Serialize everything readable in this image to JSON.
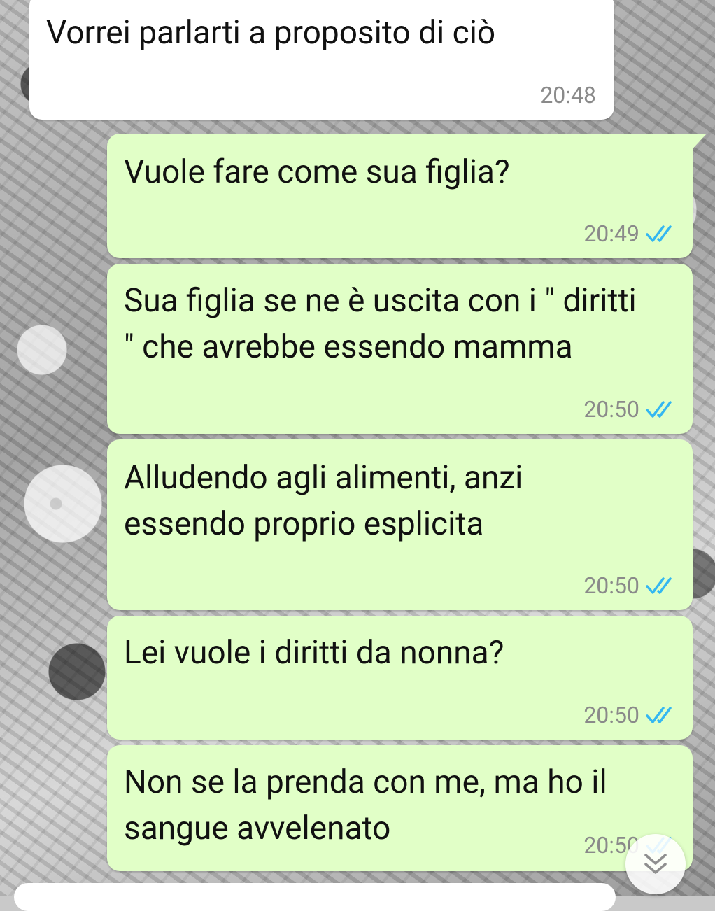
{
  "messages": [
    {
      "text": "Vorrei parlarti a proposito di ciò",
      "time": "20:48"
    },
    {
      "text": "Vuole fare come sua figlia?",
      "time": "20:49"
    },
    {
      "text": "Sua figlia se ne è uscita con i \" diritti \" che avrebbe essendo mamma",
      "time": "20:50"
    },
    {
      "text": "Alludendo agli alimenti, anzi essendo proprio esplicita",
      "time": "20:50"
    },
    {
      "text": "Lei vuole i diritti da nonna?",
      "time": "20:50"
    },
    {
      "text": "Non se la prenda con me, ma ho il sangue avvelenato",
      "time": "20:50"
    }
  ],
  "icons": {
    "read_receipt": "double-check-icon",
    "scroll_down": "double-chevron-down-icon"
  },
  "colors": {
    "incoming_bubble": "#ffffff",
    "outgoing_bubble": "#e1ffc7",
    "read_tick": "#34b7f1",
    "timestamp": "#8a8a8a"
  }
}
